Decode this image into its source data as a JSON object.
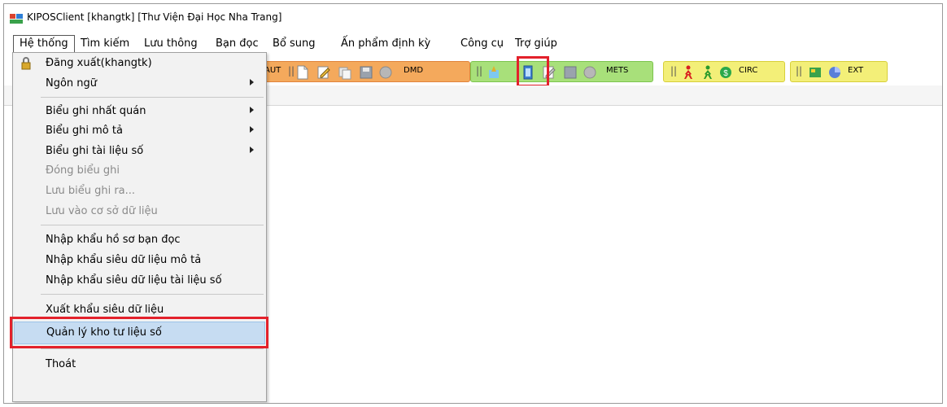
{
  "window": {
    "title": "KIPOSClient [khangtk] [Thư Viện Đại Học Nha Trang]"
  },
  "menubar": {
    "items": [
      "Hệ thống",
      "Tìm kiếm",
      "Lưu thông",
      "Bạn đọc",
      "Bổ sung",
      "Ấn phẩm định kỳ",
      "Công cụ",
      "Trợ giúp"
    ]
  },
  "toolbars": {
    "aut_label": "AUT",
    "dmd_label": "DMD",
    "mets_label": "METS",
    "circ_label": "CIRC",
    "ext_label": "EXT",
    "separator": "||"
  },
  "dropdown": {
    "logout": "Đăng xuất(khangtk)",
    "language": "Ngôn ngữ",
    "consistent_records": "Biểu ghi nhất quán",
    "descriptive_records": "Biểu ghi mô tả",
    "digital_records": "Biểu ghi tài liệu số",
    "close_record": "Đóng biểu ghi",
    "save_record_as": "Lưu biểu ghi ra...",
    "save_to_db": "Lưu vào cơ sở dữ liệu",
    "import_reader_profiles": "Nhập khẩu hồ sơ bạn đọc",
    "import_descriptive_metadata": "Nhập khẩu siêu dữ liệu mô tả",
    "import_digital_metadata": "Nhập khẩu siêu dữ liệu tài liệu số",
    "export_metadata": "Xuất khẩu siêu dữ liệu",
    "manage_digital_repository": "Quản lý kho tư liệu số",
    "exit": "Thoát"
  },
  "colors": {
    "highlight": "#c6dcf2",
    "annotation_red": "#e3212b",
    "toolbar_orange": "#f4a95c",
    "toolbar_green": "#a8e07a",
    "toolbar_yellow": "#f3ef78"
  }
}
